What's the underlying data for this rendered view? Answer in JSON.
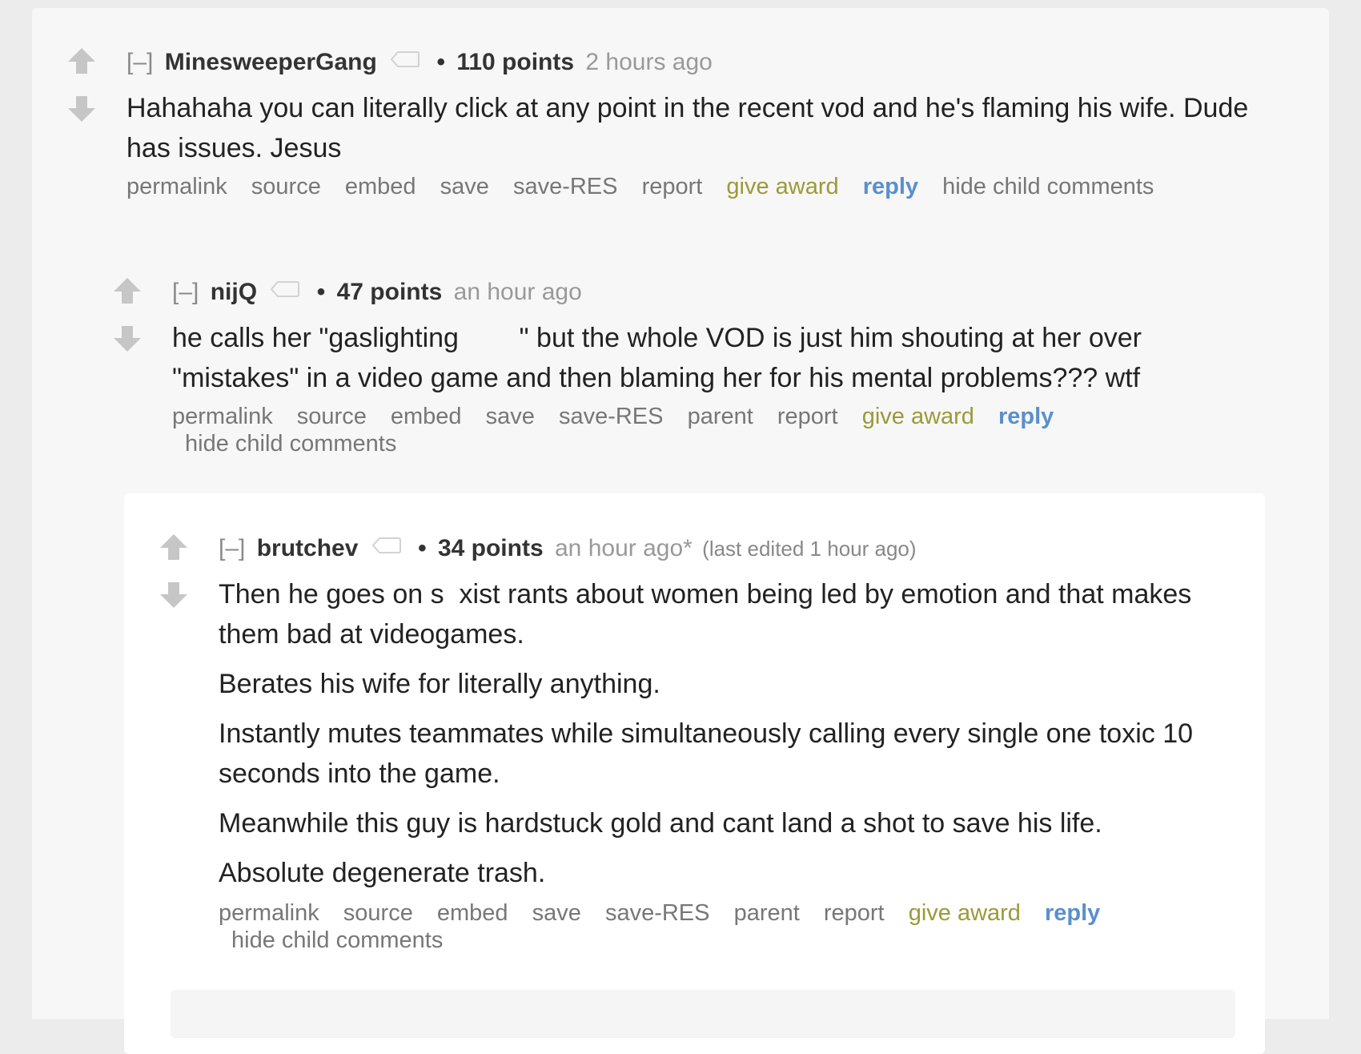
{
  "comments": [
    {
      "collapse": "[–]",
      "author": "MinesweeperGang",
      "score": "110 points",
      "time": "2 hours ago",
      "body": [
        "Hahahaha you can literally click at any point in the recent vod and he's flaming his wife. Dude has issues. Jesus"
      ],
      "buttons": {
        "permalink": "permalink",
        "source": "source",
        "embed": "embed",
        "save": "save",
        "save_res": "save-RES",
        "report": "report",
        "give_award": "give award",
        "reply": "reply",
        "hide_child": "hide child comments"
      }
    },
    {
      "collapse": "[–]",
      "author": "nijQ",
      "score": "47 points",
      "time": "an hour ago",
      "body": [
        "he calls her \"gaslighting        \" but the whole VOD is just him shouting at her over \"mistakes\" in a video game and then blaming her for his mental problems??? wtf"
      ],
      "buttons": {
        "permalink": "permalink",
        "source": "source",
        "embed": "embed",
        "save": "save",
        "save_res": "save-RES",
        "parent": "parent",
        "report": "report",
        "give_award": "give award",
        "reply": "reply",
        "hide_child": "hide child comments"
      }
    },
    {
      "collapse": "[–]",
      "author": "brutchev",
      "score": "34 points",
      "time": "an hour ago*",
      "edited": "(last edited 1 hour ago)",
      "body": [
        "Then he goes on s  xist rants about women being led by emotion and that makes them bad at videogames.",
        "Berates his wife for literally anything.",
        "Instantly mutes teammates while simultaneously calling every single one toxic 10 seconds into the game.",
        "Meanwhile this guy is hardstuck gold and cant land a shot to save his life.",
        "Absolute degenerate trash."
      ],
      "buttons": {
        "permalink": "permalink",
        "source": "source",
        "embed": "embed",
        "save": "save",
        "save_res": "save-RES",
        "parent": "parent",
        "report": "report",
        "give_award": "give award",
        "reply": "reply",
        "hide_child": "hide child comments"
      }
    }
  ],
  "icons": {
    "upvote": "upvote-arrow-icon",
    "downvote": "downvote-arrow-icon",
    "flair": "flair-tag-icon"
  },
  "colors": {
    "award": "#9a9a3a",
    "reply": "#5a8fcc",
    "arrow": "#c6c6c6"
  }
}
